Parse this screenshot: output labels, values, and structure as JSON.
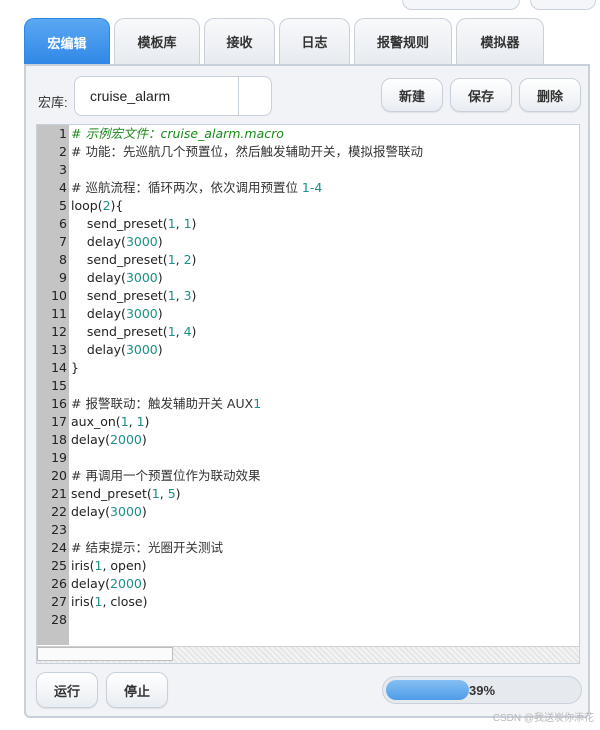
{
  "tabs": [
    {
      "label": "宏编辑",
      "active": true
    },
    {
      "label": "模板库",
      "active": false
    },
    {
      "label": "接收",
      "active": false
    },
    {
      "label": "日志",
      "active": false
    },
    {
      "label": "报警规则",
      "active": false
    },
    {
      "label": "模拟器",
      "active": false
    }
  ],
  "library": {
    "label": "宏库:",
    "value": "cruise_alarm"
  },
  "buttons": {
    "new": "新建",
    "save": "保存",
    "delete": "删除",
    "run": "运行",
    "stop": "停止"
  },
  "editor": {
    "lines": [
      "# 示例宏文件：cruise_alarm.macro",
      "# 功能：先巡航几个预置位，然后触发辅助开关，模拟报警联动",
      "",
      "# 巡航流程：循环两次，依次调用预置位 1-4",
      "loop(2){",
      "    send_preset(1, 1)",
      "    delay(3000)",
      "    send_preset(1, 2)",
      "    delay(3000)",
      "    send_preset(1, 3)",
      "    delay(3000)",
      "    send_preset(1, 4)",
      "    delay(3000)",
      "}",
      "",
      "# 报警联动：触发辅助开关 AUX1",
      "aux_on(1, 1)",
      "delay(2000)",
      "",
      "# 再调用一个预置位作为联动效果",
      "send_preset(1, 5)",
      "delay(3000)",
      "",
      "# 结束提示：光圈开关测试",
      "iris(1, open)",
      "delay(2000)",
      "iris(1, close)",
      ""
    ]
  },
  "progress": {
    "value": 0.39,
    "text": "39%"
  },
  "watermark": "CSDN @我送炭你添花"
}
